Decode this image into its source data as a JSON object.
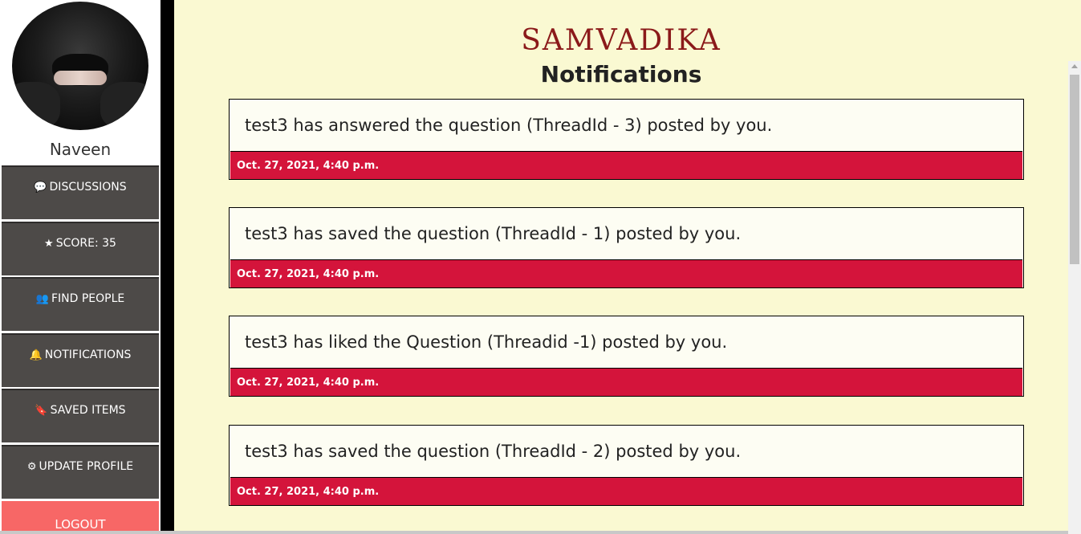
{
  "sidebar": {
    "username": "Naveen",
    "items": [
      {
        "icon": "💬",
        "icon_name": "comment-icon",
        "label": "DISCUSSIONS"
      },
      {
        "icon": "★",
        "icon_name": "star-icon",
        "label": "SCORE: 35"
      },
      {
        "icon": "👥",
        "icon_name": "users-icon",
        "label": "FIND PEOPLE"
      },
      {
        "icon": "🔔",
        "icon_name": "bell-icon",
        "label": "NOTIFICATIONS"
      },
      {
        "icon": "🔖",
        "icon_name": "bookmark-icon",
        "label": "SAVED ITEMS"
      },
      {
        "icon": "⚙",
        "icon_name": "gear-icon",
        "label": "UPDATE PROFILE"
      }
    ],
    "logout_label": "LOGOUT"
  },
  "header": {
    "brand": "SAMVADIKA",
    "title": "Notifications"
  },
  "notifications": [
    {
      "message": "test3 has answered the question (ThreadId - 3) posted by you.",
      "timestamp": "Oct. 27, 2021, 4:40 p.m."
    },
    {
      "message": "test3 has saved the question (ThreadId - 1) posted by you.",
      "timestamp": "Oct. 27, 2021, 4:40 p.m."
    },
    {
      "message": "test3 has liked the Question (Threadid -1) posted by you.",
      "timestamp": "Oct. 27, 2021, 4:40 p.m."
    },
    {
      "message": "test3 has saved the question (ThreadId - 2) posted by you.",
      "timestamp": "Oct. 27, 2021, 4:40 p.m."
    }
  ],
  "colors": {
    "brand": "#8b1a1a",
    "background": "#faf9d2",
    "sidebar_item": "#4d4a48",
    "timestamp_bar": "#d4143b",
    "logout": "#f76766"
  }
}
